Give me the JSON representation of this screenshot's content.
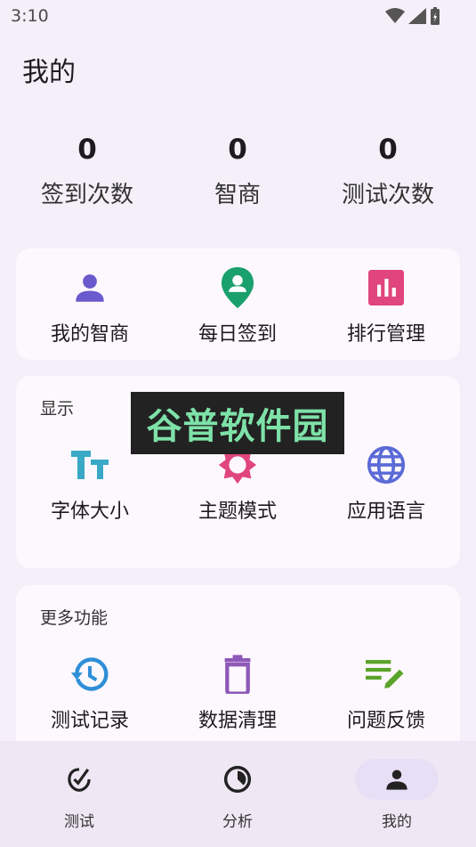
{
  "status": {
    "time": "3:10"
  },
  "page_title": "我的",
  "stats": [
    {
      "value": "0",
      "label": "签到次数"
    },
    {
      "value": "0",
      "label": "智商"
    },
    {
      "value": "0",
      "label": "测试次数"
    }
  ],
  "quick": {
    "items": [
      {
        "label": "我的智商",
        "icon": "person-icon",
        "color": "#6a5acd"
      },
      {
        "label": "每日签到",
        "icon": "location-pin-icon",
        "color": "#1aa06d"
      },
      {
        "label": "排行管理",
        "icon": "bar-chart-icon",
        "color": "#e0457b"
      }
    ]
  },
  "display": {
    "title": "显示",
    "items": [
      {
        "label": "字体大小",
        "icon": "font-size-icon",
        "color": "#39a9c6"
      },
      {
        "label": "主题模式",
        "icon": "brightness-icon",
        "color": "#e0457b"
      },
      {
        "label": "应用语言",
        "icon": "globe-icon",
        "color": "#5b6ad6"
      }
    ]
  },
  "more": {
    "title": "更多功能",
    "items": [
      {
        "label": "测试记录",
        "icon": "history-icon",
        "color": "#2f8fd8"
      },
      {
        "label": "数据清理",
        "icon": "trash-icon",
        "color": "#8e59b8"
      },
      {
        "label": "问题反馈",
        "icon": "edit-notes-icon",
        "color": "#5aa32a"
      }
    ]
  },
  "watermark": "谷普软件园",
  "nav": [
    {
      "label": "测试",
      "icon": "check-badge-icon"
    },
    {
      "label": "分析",
      "icon": "pie-icon"
    },
    {
      "label": "我的",
      "icon": "person-icon"
    }
  ]
}
